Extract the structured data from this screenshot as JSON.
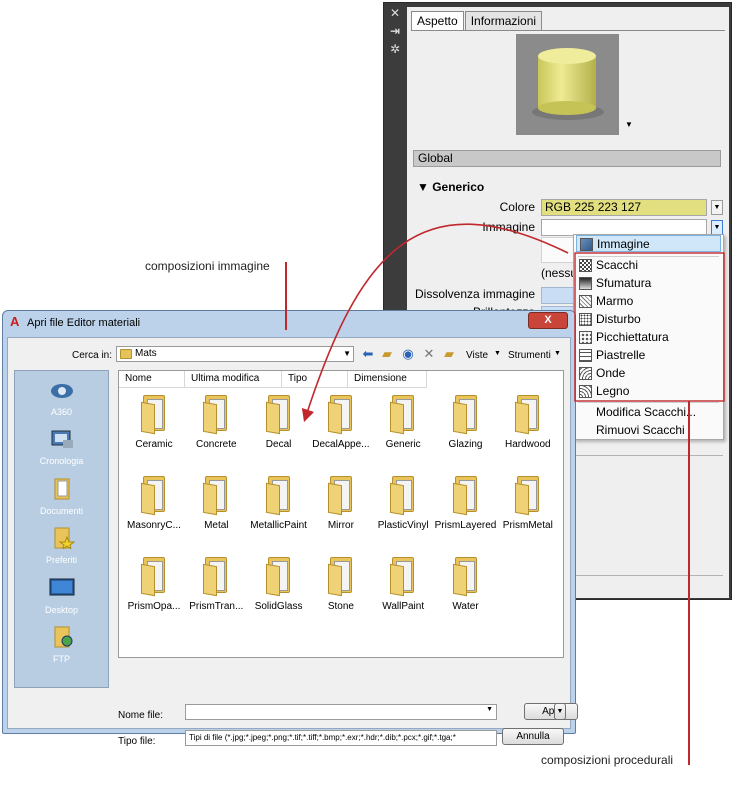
{
  "colors": {
    "annotation_red": "#c0282d",
    "material_yellow": "#e1df7f"
  },
  "panel": {
    "side_icons": [
      "close-icon",
      "pin-icon",
      "settings-icon"
    ],
    "tabs": [
      "Aspetto",
      "Informazioni"
    ],
    "section": "Global",
    "group_title": "Generico",
    "fields": {
      "color_label": "Colore",
      "color_value": "RGB 225 223 127",
      "image_label": "Immagine",
      "none_text": "(nessu",
      "fade_label": "Dissolvenza immagine",
      "gloss_label": "Brillantezza"
    }
  },
  "menu": {
    "items": [
      "Immagine",
      "Scacchi",
      "Sfumatura",
      "Marmo",
      "Disturbo",
      "Picchiettatura",
      "Piastrelle",
      "Onde",
      "Legno"
    ],
    "actions": [
      "Modifica Scacchi...",
      "Rimuovi Scacchi"
    ]
  },
  "dialog": {
    "title": "Apri file Editor materiali",
    "close_glyph": "X",
    "look_in_label": "Cerca in:",
    "look_in_value": "Mats",
    "toolbar": {
      "views": "Viste",
      "tools": "Strumenti"
    },
    "places": [
      "A360",
      "Cronologia",
      "Documenti",
      "Preferiti",
      "Desktop",
      "FTP"
    ],
    "columns": [
      "Nome",
      "Ultima modifica",
      "Tipo",
      "Dimensione"
    ],
    "folders": [
      "Ceramic",
      "Concrete",
      "Decal",
      "DecalAppe...",
      "Generic",
      "Glazing",
      "Hardwood",
      "MasonryC...",
      "Metal",
      "MetallicPaint",
      "Mirror",
      "PlasticVinyl",
      "PrismLayered",
      "PrismMetal",
      "PrismOpa...",
      "PrismTran...",
      "SolidGlass",
      "Stone",
      "WallPaint",
      "Water"
    ],
    "filename_label": "Nome file:",
    "filetype_label": "Tipo file:",
    "filetype_value": "Tipi di file (*.jpg;*.jpeg;*.png;*.tif;*.tiff;*.bmp;*.exr;*.hdr;*.dib;*.pcx;*.gif;*.tga;*",
    "open_button": "Apri",
    "cancel_button": "Annulla"
  },
  "annotations": {
    "image_compositions": "composizioni immagine",
    "procedural_compositions": "composizioni procedurali"
  }
}
